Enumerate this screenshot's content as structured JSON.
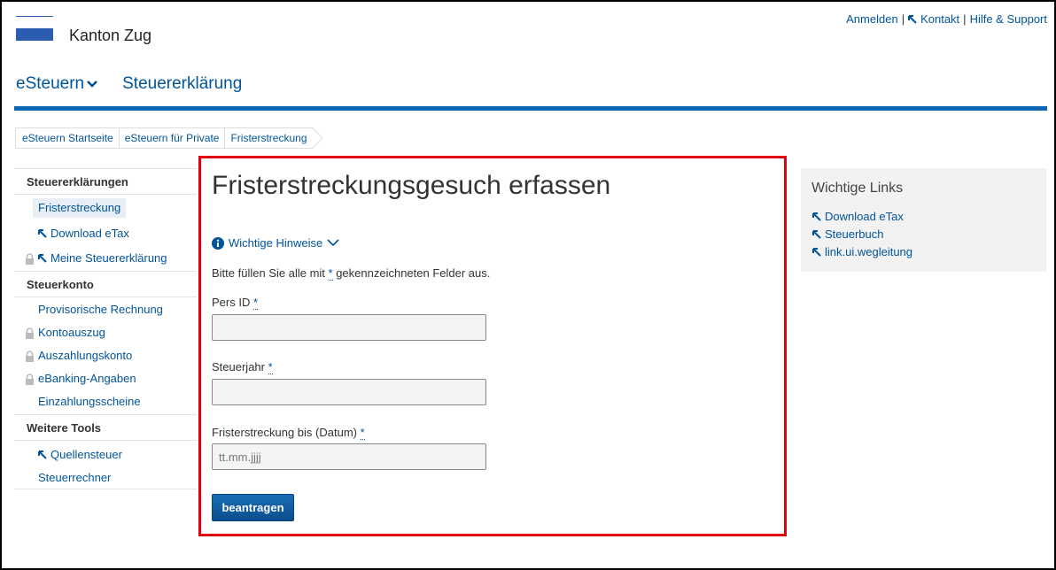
{
  "brand": {
    "name": "Kanton Zug",
    "accent": "#2a5db0"
  },
  "toplinks": {
    "login": "Anmelden",
    "sep": "|",
    "contact": "Kontakt",
    "help": "Hilfe & Support"
  },
  "mainnav": {
    "esteuern": "eSteuern",
    "steuererklaerung": "Steuererklärung"
  },
  "breadcrumb": [
    "eSteuern Startseite",
    "eSteuern für Private",
    "Fristerstreckung"
  ],
  "sidebar": {
    "sections": [
      {
        "title": "Steuererklärungen",
        "items": [
          {
            "label": "Fristerstreckung",
            "active": true,
            "icon": ""
          },
          {
            "label": "Download eTax",
            "icon": "external-arrow-icon"
          },
          {
            "label": "Meine Steuererklärung",
            "icon": "lock-icon"
          }
        ]
      },
      {
        "title": "Steuerkonto",
        "items": [
          {
            "label": "Provisorische Rechnung",
            "icon": ""
          },
          {
            "label": "Kontoauszug",
            "icon": "lock-icon"
          },
          {
            "label": "Auszahlungskonto",
            "icon": "lock-icon"
          },
          {
            "label": "eBanking-Angaben",
            "icon": "lock-icon"
          },
          {
            "label": "Einzahlungsscheine",
            "icon": ""
          }
        ]
      },
      {
        "title": "Weitere Tools",
        "items": [
          {
            "label": "Quellensteuer",
            "icon": "external-arrow-icon"
          },
          {
            "label": "Steuerrechner",
            "icon": ""
          }
        ]
      }
    ]
  },
  "form": {
    "title": "Fristerstreckungsgesuch erfassen",
    "hints": "Wichtige Hinweise",
    "required_note_pre": "Bitte füllen Sie alle mit ",
    "required_star": "*",
    "required_note_post": " gekennzeichneten Felder aus.",
    "fields": [
      {
        "label": "Pers ID ",
        "value": "",
        "placeholder": ""
      },
      {
        "label": "Steuerjahr ",
        "value": "",
        "placeholder": ""
      },
      {
        "label": "Fristerstreckung bis (Datum) ",
        "value": "",
        "placeholder": "tt.mm.jjjj"
      }
    ],
    "submit": "beantragen"
  },
  "rightbox": {
    "title": "Wichtige Links",
    "links": [
      "Download eTax",
      "Steuerbuch",
      "link.ui.wegleitung"
    ]
  }
}
